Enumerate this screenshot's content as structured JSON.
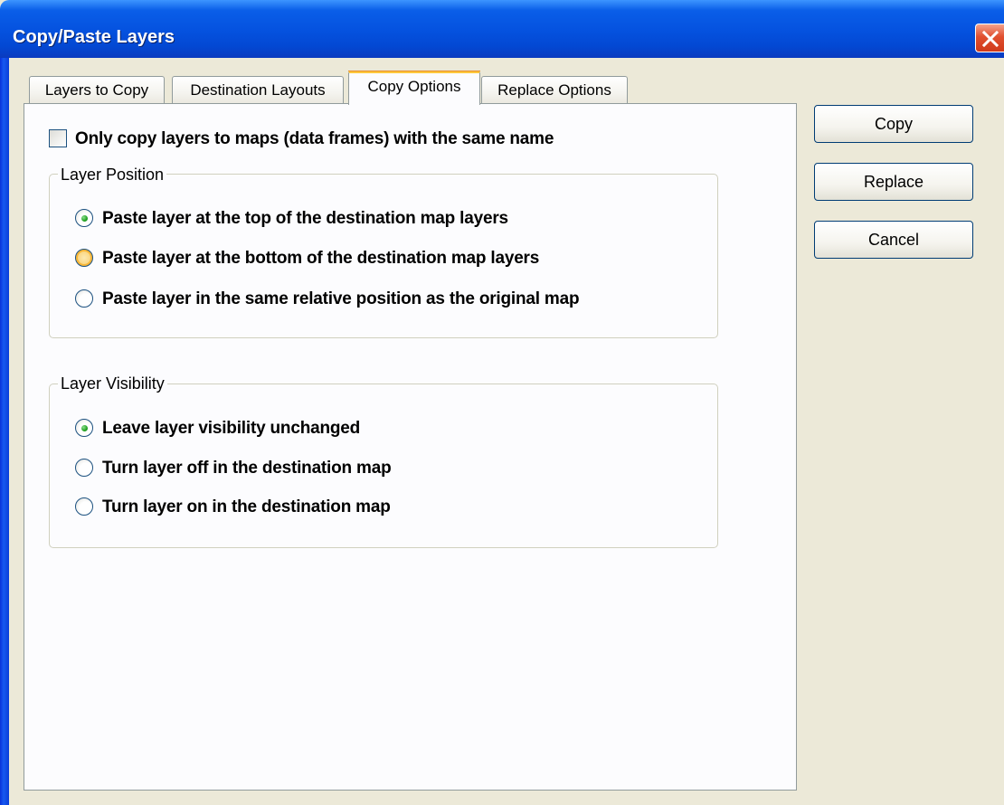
{
  "window": {
    "title": "Copy/Paste Layers"
  },
  "tabs": [
    {
      "label": "Layers to Copy",
      "active": false
    },
    {
      "label": "Destination Layouts",
      "active": false
    },
    {
      "label": "Copy Options",
      "active": true
    },
    {
      "label": "Replace Options",
      "active": false
    }
  ],
  "options": {
    "same_name_checkbox": {
      "label": "Only copy layers to maps (data frames) with the same name",
      "checked": false
    }
  },
  "layer_position": {
    "title": "Layer Position",
    "options": [
      {
        "label": "Paste layer at the top of the destination map layers",
        "selected": true
      },
      {
        "label": "Paste layer at the bottom of the destination map layers",
        "selected": false
      },
      {
        "label": "Paste layer in the same relative position as the original map",
        "selected": false
      }
    ]
  },
  "layer_visibility": {
    "title": "Layer Visibility",
    "options": [
      {
        "label": "Leave layer visibility unchanged",
        "selected": true
      },
      {
        "label": "Turn layer off in the destination map",
        "selected": false
      },
      {
        "label": "Turn layer on in the destination map",
        "selected": false
      }
    ]
  },
  "buttons": {
    "copy": "Copy",
    "replace": "Replace",
    "cancel": "Cancel"
  },
  "colors": {
    "titlebar": "#0553e0",
    "dialog_bg": "#ece9d8",
    "active_tab_accent": "#ffc83c",
    "radio_selected": "#21a121"
  }
}
